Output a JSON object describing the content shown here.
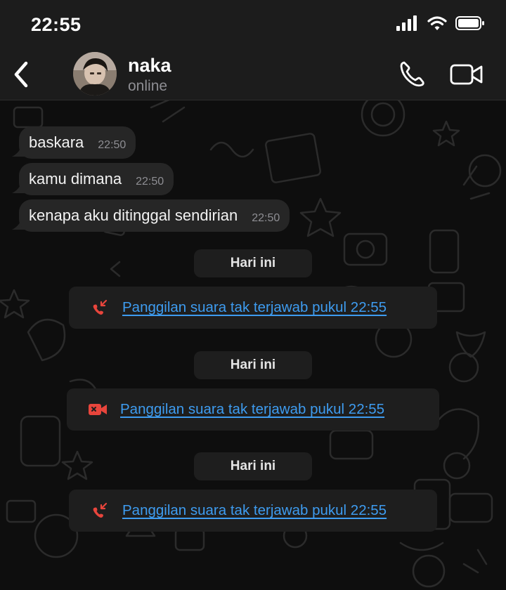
{
  "status_bar": {
    "time": "22:55"
  },
  "header": {
    "contact_name": "naka",
    "contact_status": "online",
    "icons": [
      "back-chevron-icon",
      "phone-icon",
      "video-camera-icon"
    ]
  },
  "messages": [
    {
      "text": "baskara",
      "time": "22:50"
    },
    {
      "text": "kamu dimana",
      "time": "22:50"
    },
    {
      "text": "kenapa aku ditinggal sendirian",
      "time": "22:50"
    }
  ],
  "events": [
    {
      "date_label": "Hari ini",
      "call_text": "Panggilan suara tak terjawab pukul 22:55",
      "icon": "missed-voice-call-icon"
    },
    {
      "date_label": "Hari ini",
      "call_text": "Panggilan suara tak terjawab pukul 22:55",
      "icon": "missed-video-call-icon"
    },
    {
      "date_label": "Hari ini",
      "call_text": "Panggilan suara tak terjawab pukul 22:55",
      "icon": "missed-voice-call-icon"
    }
  ],
  "colors": {
    "link": "#3e9cf0",
    "missed": "#e8453c",
    "bubble": "#262626",
    "header": "#1c1c1c"
  }
}
